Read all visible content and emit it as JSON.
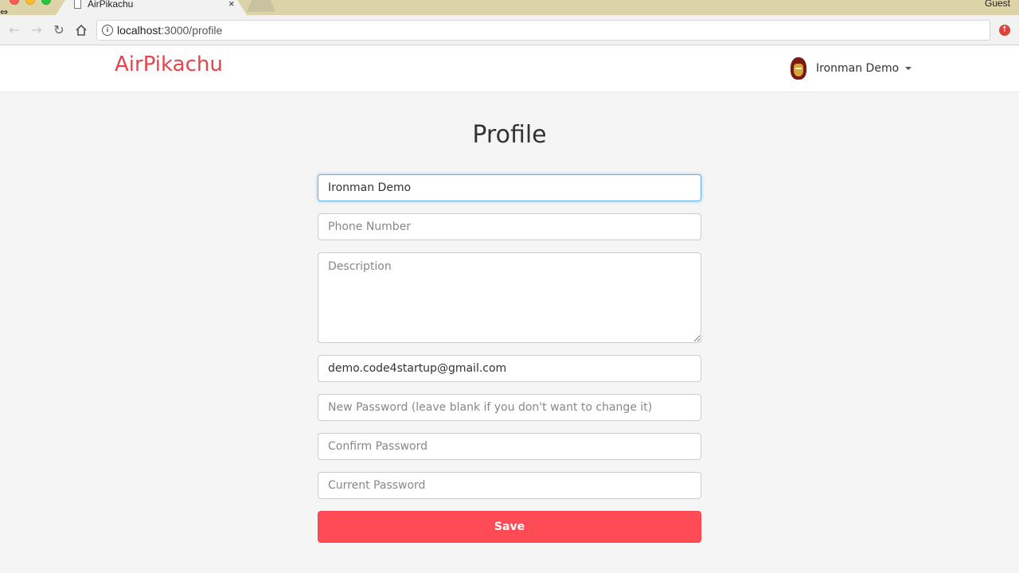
{
  "browser": {
    "tab_title": "AirPikachu",
    "tab_close": "×",
    "profile": "Guest",
    "url_host": "localhost",
    "url_path": ":3000/profile"
  },
  "navbar": {
    "brand": "AirPikachu",
    "user_name": "Ironman Demo"
  },
  "form": {
    "title": "Profile",
    "fullname_value": "Ironman Demo",
    "phone_placeholder": "Phone Number",
    "description_placeholder": "Description",
    "email_value": "demo.code4startup@gmail.com",
    "new_password_placeholder": "New Password (leave blank if you don't want to change it)",
    "confirm_password_placeholder": "Confirm Password",
    "current_password_placeholder": "Current Password",
    "save_label": "Save"
  },
  "colors": {
    "brand": "#e2464b",
    "save_button": "#ff4b56",
    "focus_border": "#66afe9"
  },
  "icons": {
    "back": "arrow-left-icon",
    "forward": "arrow-right-icon",
    "reload": "reload-icon",
    "home": "home-icon",
    "site_info": "info-icon",
    "update": "update-icon",
    "menu_caret": "caret-down-icon"
  }
}
